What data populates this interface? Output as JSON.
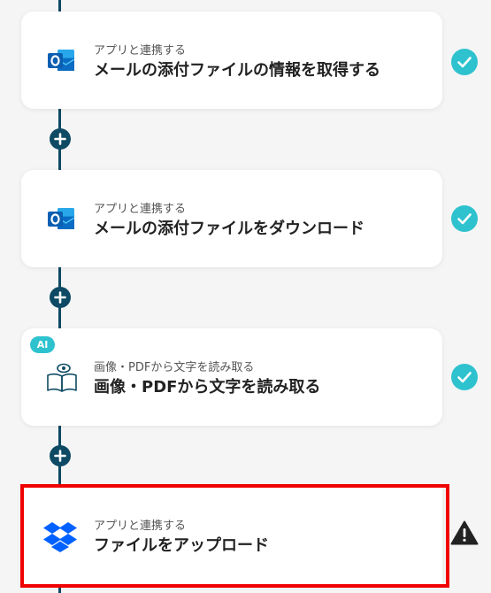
{
  "steps": [
    {
      "subtitle": "アプリと連携する",
      "title": "メールの添付ファイルの情報を取得する",
      "app_icon": "outlook-icon",
      "status": "completed",
      "status_icon": "check-circle-icon"
    },
    {
      "subtitle": "アプリと連携する",
      "title": "メールの添付ファイルをダウンロード",
      "app_icon": "outlook-icon",
      "status": "completed",
      "status_icon": "check-circle-icon"
    },
    {
      "subtitle": "画像・PDFから文字を読み取る",
      "title": "画像・PDFから文字を読み取る",
      "app_icon": "book-eye-ocr-icon",
      "badge": "AI",
      "status": "completed",
      "status_icon": "check-circle-icon"
    },
    {
      "subtitle": "アプリと連携する",
      "title": "ファイルをアップロード",
      "app_icon": "dropbox-icon",
      "status": "warning",
      "status_icon": "warning-triangle-icon",
      "highlighted": true
    }
  ],
  "add_step_icon": "plus-icon",
  "colors": {
    "background": "#f5f5f5",
    "flow_line": "#0e4a63",
    "check_teal": "#2ec2cf",
    "highlight_red": "#f00000",
    "outlook_blue": "#0a6cc2",
    "dropbox_blue": "#0061fe"
  }
}
